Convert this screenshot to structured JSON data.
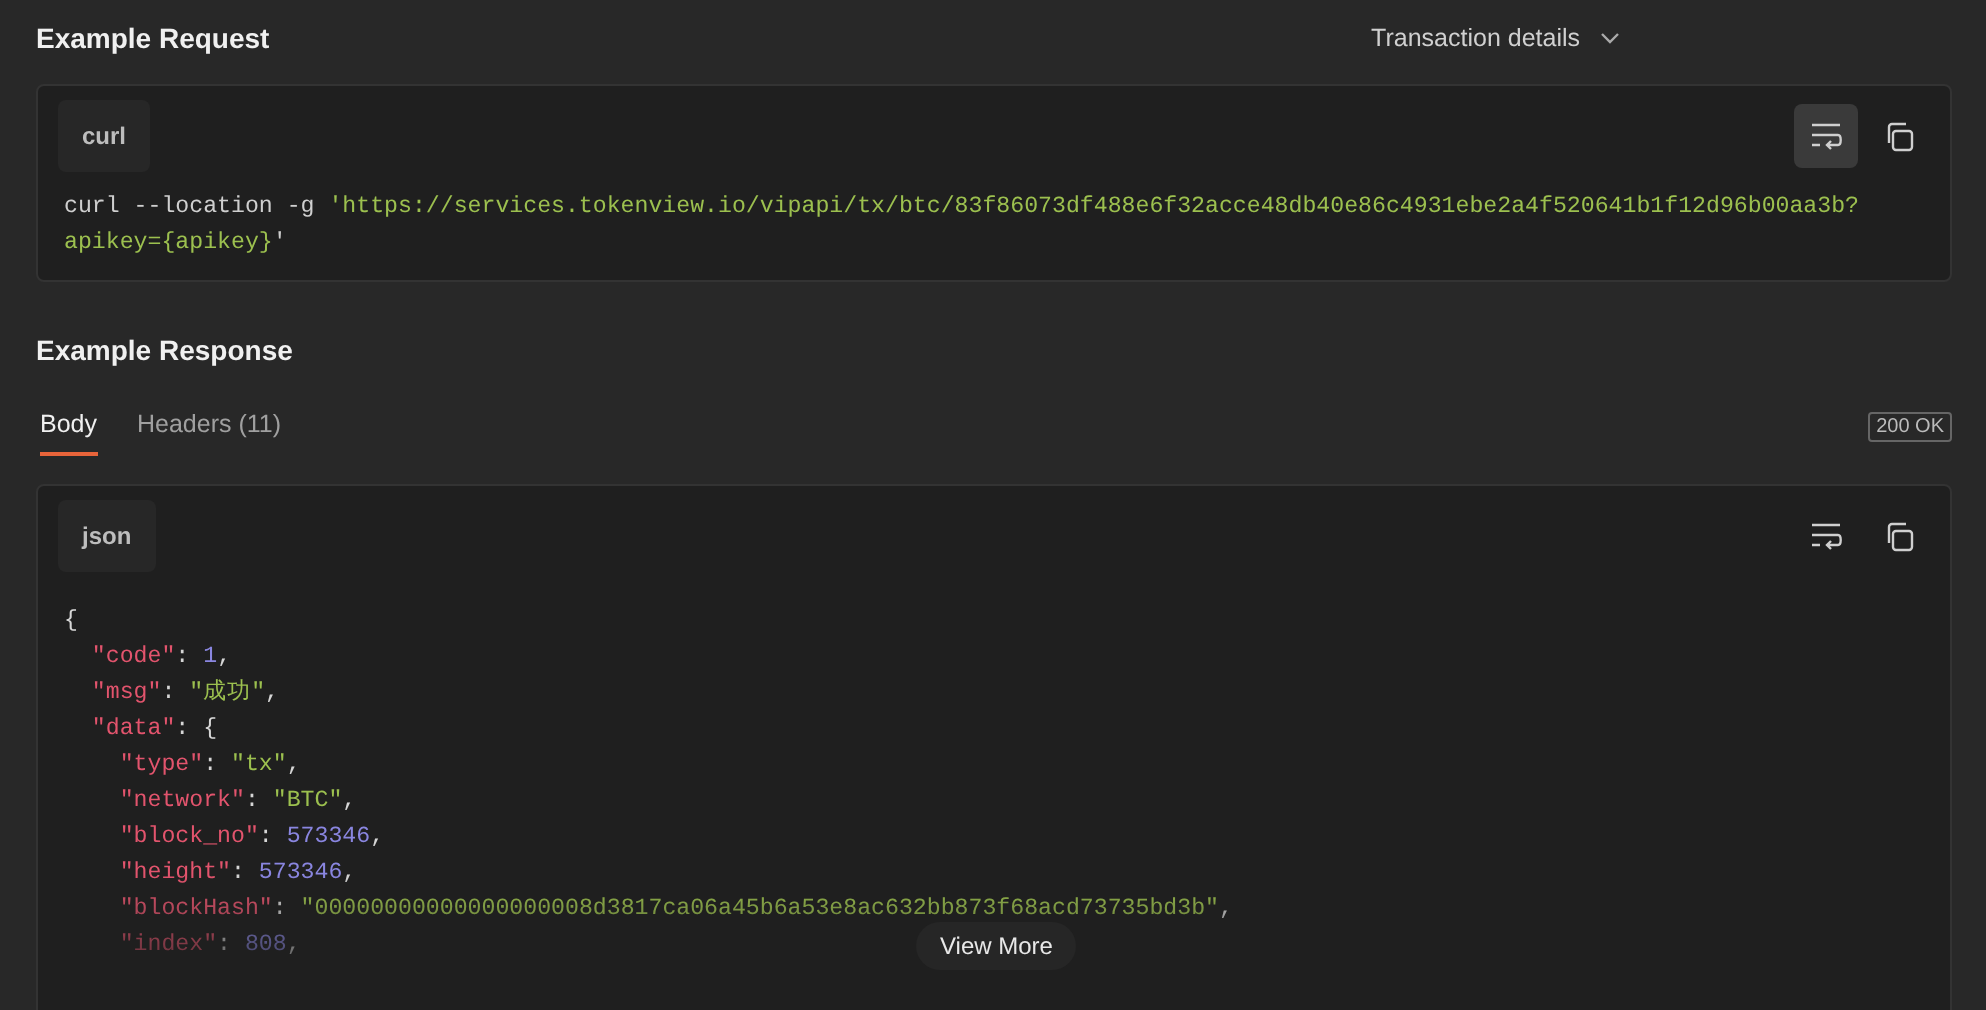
{
  "request": {
    "title": "Example Request",
    "example_picker": "Transaction details",
    "language": "curl",
    "wrap_on": true,
    "lines": [
      [
        {
          "kind": "plain",
          "text": "curl --location -g "
        },
        {
          "kind": "str",
          "text": "'https://services.tokenview.io/vipapi/tx/btc/83f86073df488e6f32acce48db40e86c4931ebe2a4f520641b1f12d96b00aa3b?"
        }
      ],
      [
        {
          "kind": "str",
          "text": "apikey={apikey}"
        },
        {
          "kind": "plain",
          "text": "'"
        }
      ]
    ]
  },
  "response": {
    "title": "Example Response",
    "tabs": [
      {
        "label": "Body",
        "selected": true
      },
      {
        "label": "Headers (11)",
        "selected": false
      }
    ],
    "status": "200 OK",
    "language": "json",
    "wrap_on": false,
    "lines": [
      [
        {
          "kind": "punct",
          "text": "{"
        }
      ],
      [
        {
          "kind": "key",
          "text": "  \"code\""
        },
        {
          "kind": "punct",
          "text": ": "
        },
        {
          "kind": "num",
          "text": "1"
        },
        {
          "kind": "punct",
          "text": ","
        }
      ],
      [
        {
          "kind": "key",
          "text": "  \"msg\""
        },
        {
          "kind": "punct",
          "text": ": "
        },
        {
          "kind": "str",
          "text": "\"成功\""
        },
        {
          "kind": "punct",
          "text": ","
        }
      ],
      [
        {
          "kind": "key",
          "text": "  \"data\""
        },
        {
          "kind": "punct",
          "text": ": {"
        }
      ],
      [
        {
          "kind": "key",
          "text": "    \"type\""
        },
        {
          "kind": "punct",
          "text": ": "
        },
        {
          "kind": "str",
          "text": "\"tx\""
        },
        {
          "kind": "punct",
          "text": ","
        }
      ],
      [
        {
          "kind": "key",
          "text": "    \"network\""
        },
        {
          "kind": "punct",
          "text": ": "
        },
        {
          "kind": "str",
          "text": "\"BTC\""
        },
        {
          "kind": "punct",
          "text": ","
        }
      ],
      [
        {
          "kind": "key",
          "text": "    \"block_no\""
        },
        {
          "kind": "punct",
          "text": ": "
        },
        {
          "kind": "num",
          "text": "573346"
        },
        {
          "kind": "punct",
          "text": ","
        }
      ],
      [
        {
          "kind": "key",
          "text": "    \"height\""
        },
        {
          "kind": "punct",
          "text": ": "
        },
        {
          "kind": "num",
          "text": "573346"
        },
        {
          "kind": "punct",
          "text": ","
        }
      ],
      [
        {
          "kind": "key",
          "text": "    \"blockHash\""
        },
        {
          "kind": "punct",
          "text": ": "
        },
        {
          "kind": "str",
          "text": "\"00000000000000000008d3817ca06a45b6a53e8ac632bb873f68acd73735bd3b\""
        },
        {
          "kind": "punct",
          "text": ","
        }
      ],
      [
        {
          "kind": "key",
          "text": "    \"index\""
        },
        {
          "kind": "punct",
          "text": ": "
        },
        {
          "kind": "num",
          "text": "808"
        },
        {
          "kind": "punct",
          "text": ","
        }
      ]
    ],
    "view_more": "View More"
  }
}
